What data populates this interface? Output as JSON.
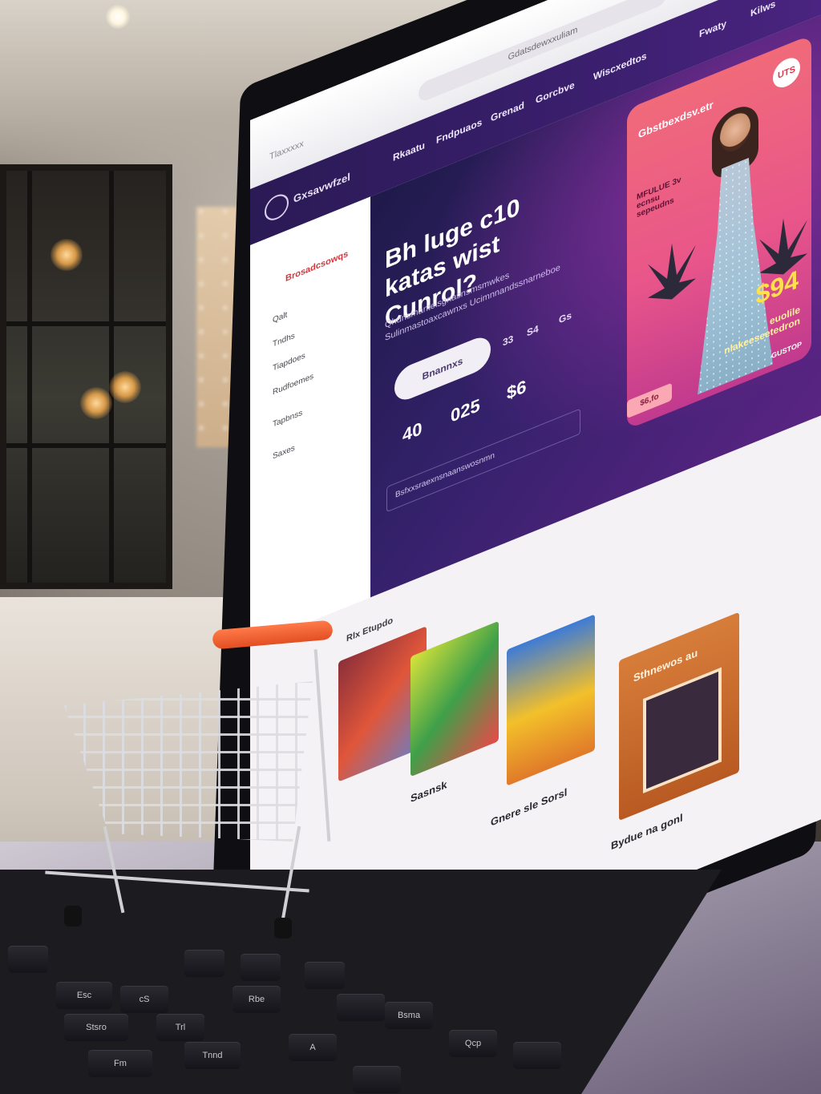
{
  "browser": {
    "url": "Gdatsdewxxuliam",
    "tab_title": "Tlaxxxxx",
    "close_icon": "close-icon",
    "profile_icon": "profile-icon"
  },
  "site": {
    "logo_text": "Gxsavwfzel",
    "nav": [
      "Rkaatu",
      "Fndpuaos",
      "Grenad",
      "Gorcbve",
      "Wiscxedtos",
      "Fwaty",
      "Kilws"
    ]
  },
  "sidebar": {
    "title": "Brosadcsowqs",
    "items": [
      "Qalt",
      "Tndhs",
      "Tiapdoes",
      "Rudfoemes",
      "Tapbnss",
      "Saxes"
    ]
  },
  "hero": {
    "title": "Bh luge c10 katas wist Cunrol?",
    "subtitle": "Qhdnsmanteisgnasnsmsmwkes Sulinmastoaxcawnxs Ucimnnandssnarneboe",
    "cta_label": "Bnannxs",
    "small_labels": [
      "33",
      "S4",
      "Gs"
    ],
    "stats": [
      "40",
      "025",
      "$6"
    ],
    "search_placeholder": "Bsfxxsraexnsnaanswosnmn"
  },
  "promo": {
    "title": "Gbstbexdsv.etr",
    "badge": "UTS",
    "side_text": "MFULUE 3v ecnsu sepeudns",
    "price": "$94",
    "foot_line1": "euolile",
    "foot_line2": "nlakeeseetedron",
    "chip": "$6,fo",
    "corner": "GUSTOP"
  },
  "products": {
    "section_label": "Rlx Etupdo",
    "items": [
      {
        "caption": "",
        "colors": [
          "#8b2f3a",
          "#e0563a",
          "#6a7fc4"
        ]
      },
      {
        "caption": "Sasnsk",
        "colors": [
          "#d8e23a",
          "#3fa04a",
          "#e84a4a"
        ]
      },
      {
        "caption": "Gnere sle Sorsl",
        "colors": [
          "#3e7bd6",
          "#f3c02a",
          "#e07a2a"
        ]
      },
      {
        "caption": "Bydue na gonl",
        "colors": [
          "#d77d3a",
          "#b85a22",
          "#fbe2c4"
        ],
        "label": "Sthnewos au"
      }
    ]
  },
  "colors": {
    "hero_gradient_start": "#1f1a4a",
    "hero_gradient_end": "#5a2483",
    "promo_pink": "#f06a7a",
    "cart_handle": "#e24f22"
  },
  "keyboard_keys": [
    "Esc",
    "Stsro",
    "Fm",
    "Tnnd",
    "cS",
    "Trl",
    "Rbe",
    "Bsma",
    "A",
    "Qcp"
  ]
}
